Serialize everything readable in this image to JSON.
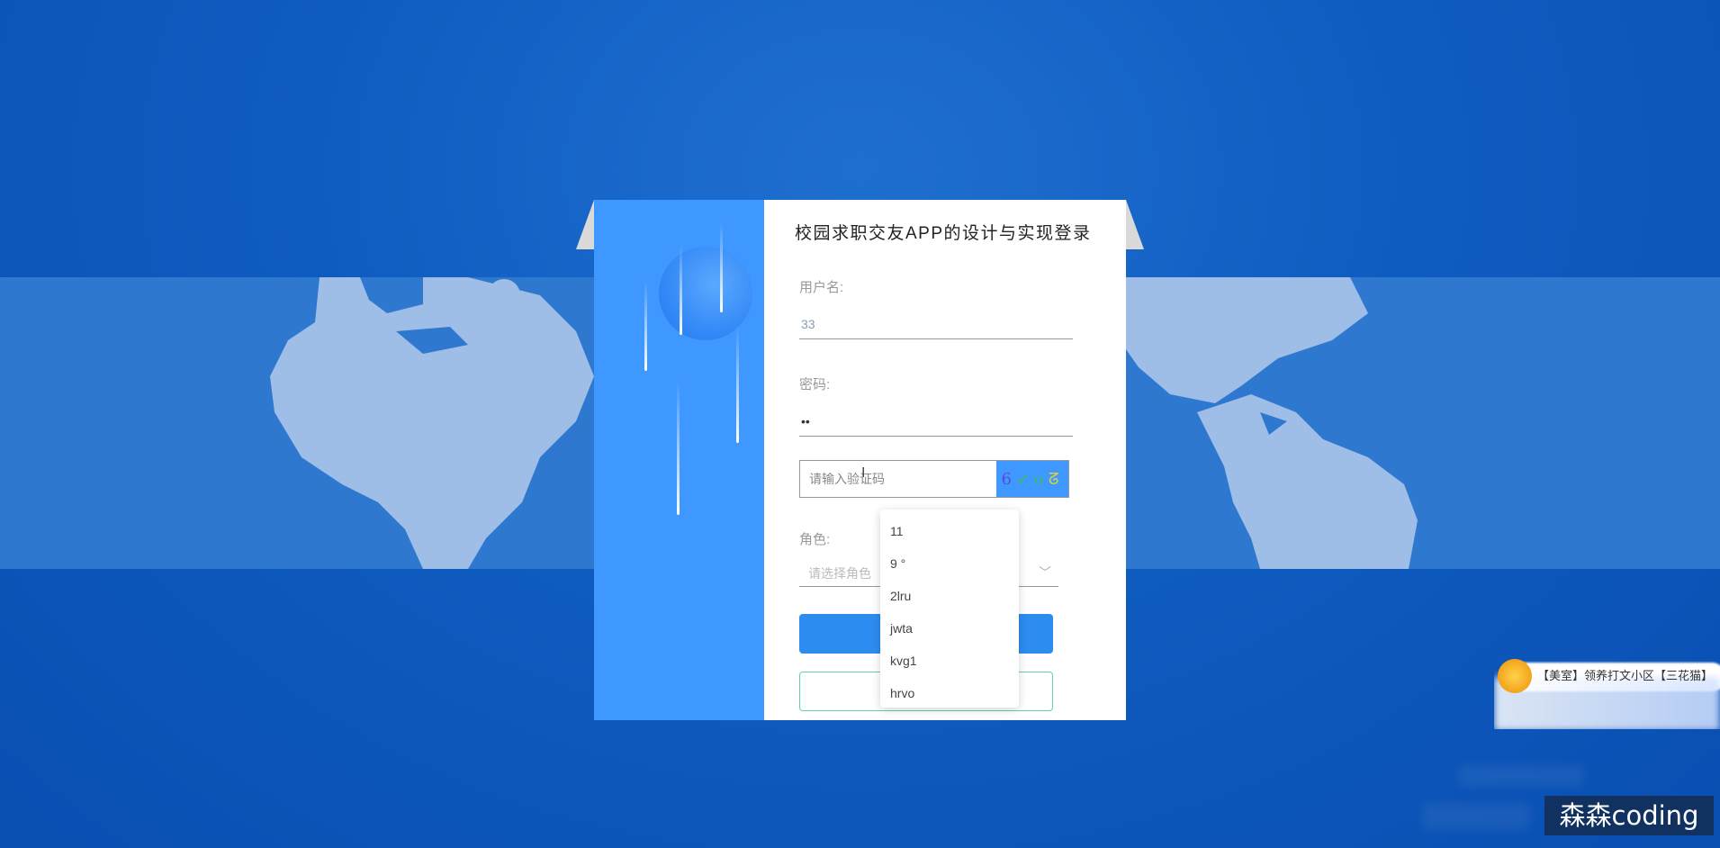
{
  "login": {
    "title": "校园求职交友APP的设计与实现登录",
    "username_label": "用户名:",
    "username_value": "33",
    "password_label": "密码:",
    "password_value": "••",
    "captcha_placeholder": "请输入验证码",
    "captcha_code": [
      "6",
      "↙",
      "o",
      "ᘔ"
    ],
    "role_label": "角色:",
    "role_placeholder": "请选择角色"
  },
  "role_dropdown": {
    "options": [
      "11",
      "9 °",
      "2lru",
      "jwta",
      "kvg1",
      "hrvo"
    ]
  },
  "notification": {
    "text": "【美室】领养打文小区【三花猫】"
  },
  "watermark": "森森coding",
  "colors": {
    "background": "#0f5cc0",
    "panel_blue": "#3f98ff",
    "primary_button": "#2d8cf0",
    "register_border": "#5fd0b0"
  }
}
